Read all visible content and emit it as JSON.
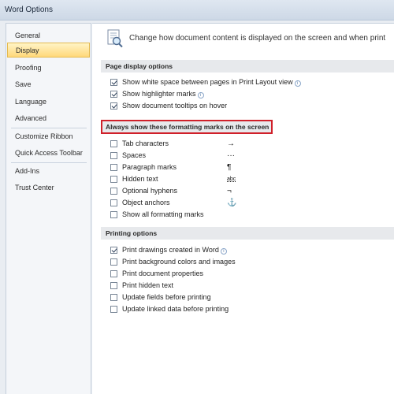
{
  "window": {
    "title": "Word Options"
  },
  "sidebar": {
    "items": [
      {
        "label": "General"
      },
      {
        "label": "Display"
      },
      {
        "label": "Proofing"
      },
      {
        "label": "Save"
      },
      {
        "label": "Language"
      },
      {
        "label": "Advanced"
      },
      {
        "label": "Customize Ribbon"
      },
      {
        "label": "Quick Access Toolbar"
      },
      {
        "label": "Add-Ins"
      },
      {
        "label": "Trust Center"
      }
    ],
    "selected": "Display"
  },
  "header": {
    "text": "Change how document content is displayed on the screen and when print"
  },
  "page_display": {
    "title": "Page display options",
    "options": [
      {
        "label": "Show white space between pages in Print Layout view",
        "checked": true
      },
      {
        "label": "Show highlighter marks",
        "checked": true
      },
      {
        "label": "Show document tooltips on hover",
        "checked": true
      }
    ]
  },
  "formatting_marks": {
    "title": "Always show these formatting marks on the screen",
    "options": [
      {
        "label": "Tab characters",
        "checked": false,
        "symbol": "→"
      },
      {
        "label": "Spaces",
        "checked": false,
        "symbol": "···"
      },
      {
        "label": "Paragraph marks",
        "checked": false,
        "symbol": "¶"
      },
      {
        "label": "Hidden text",
        "checked": false,
        "symbol": "abc"
      },
      {
        "label": "Optional hyphens",
        "checked": false,
        "symbol": "¬"
      },
      {
        "label": "Object anchors",
        "checked": false,
        "symbol": "⚓"
      },
      {
        "label": "Show all formatting marks",
        "checked": false
      }
    ]
  },
  "printing": {
    "title": "Printing options",
    "options": [
      {
        "label": "Print drawings created in Word",
        "checked": true
      },
      {
        "label": "Print background colors and images",
        "checked": false
      },
      {
        "label": "Print document properties",
        "checked": false
      },
      {
        "label": "Print hidden text",
        "checked": false
      },
      {
        "label": "Update fields before printing",
        "checked": false
      },
      {
        "label": "Update linked data before printing",
        "checked": false
      }
    ]
  }
}
